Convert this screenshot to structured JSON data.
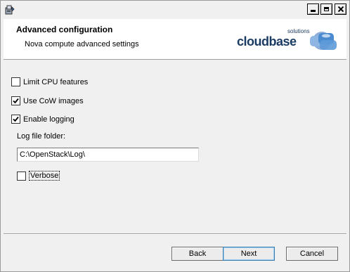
{
  "window": {
    "app_icon": "installer-icon",
    "controls": [
      "minimize-icon",
      "maximize-icon",
      "close-icon"
    ]
  },
  "banner": {
    "title": "Advanced configuration",
    "subtitle": "Nova compute advanced settings",
    "logo": "cloudbase solutions logo"
  },
  "options": {
    "limit_cpu": {
      "label": "Limit CPU features",
      "checked": false
    },
    "use_cow": {
      "label": "Use CoW images",
      "checked": true
    },
    "enable_logging": {
      "label": "Enable logging",
      "checked": true
    },
    "verbose": {
      "label": "Verbose",
      "checked": false
    }
  },
  "log_folder": {
    "label": "Log file folder:",
    "value": "C:\\OpenStack\\Log\\"
  },
  "buttons": {
    "back": "Back",
    "next": "Next",
    "cancel": "Cancel"
  },
  "colors": {
    "logo_text": "#1b3b63",
    "logo_accent": "#4a8ad0",
    "default_button_border": "#3c7fb1"
  }
}
